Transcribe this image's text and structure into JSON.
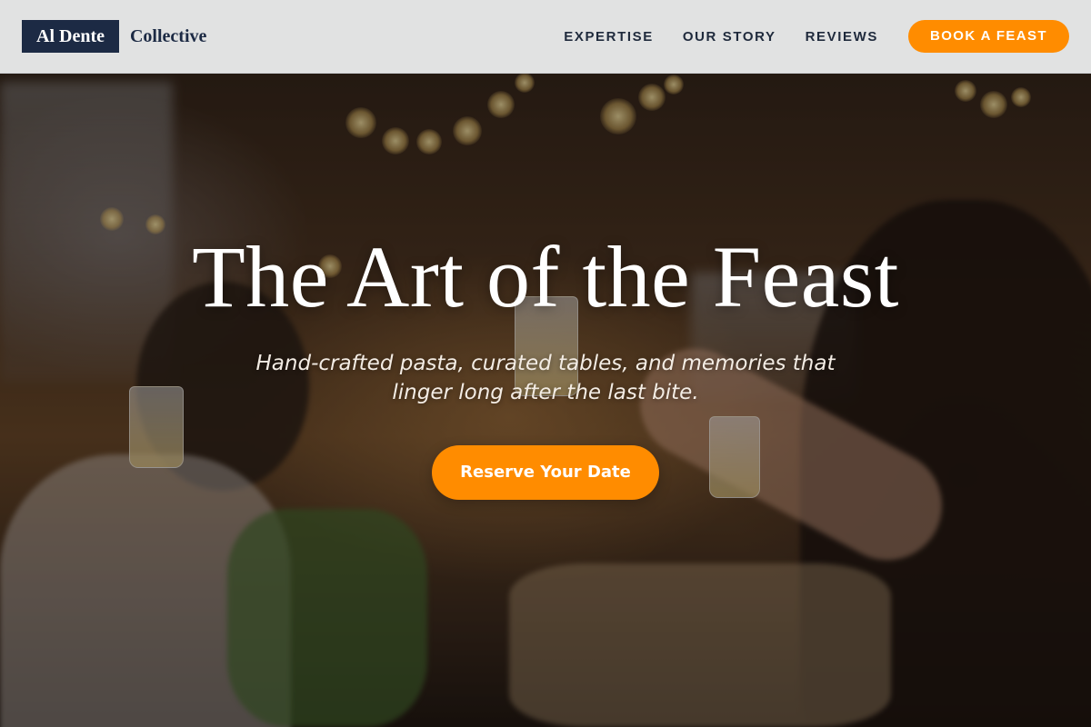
{
  "header": {
    "brand_primary": "Al Dente",
    "brand_secondary": "Collective",
    "nav": [
      {
        "label": "EXPERTISE"
      },
      {
        "label": "OUR STORY"
      },
      {
        "label": "REVIEWS"
      }
    ],
    "cta_label": "BOOK A FEAST"
  },
  "hero": {
    "title": "The Art of the Feast",
    "subtitle": "Hand-crafted pasta, curated tables, and memories that linger long after the last bite.",
    "cta_label": "Reserve Your Date",
    "background_image": "dinner-party-toast-photo"
  },
  "colors": {
    "accent": "#ff8c00",
    "brand_navy": "#1c2a44",
    "header_bg": "#ecedee",
    "text_light": "#ffffff"
  }
}
